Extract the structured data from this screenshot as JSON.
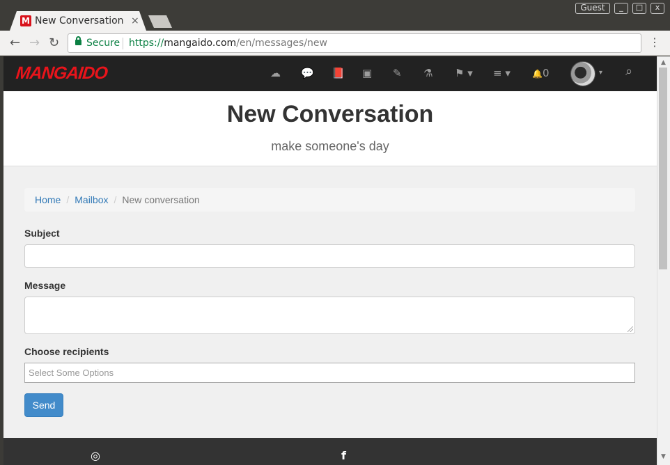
{
  "browser": {
    "tab_title": "New Conversation",
    "tab_close": "×",
    "favicon_letter": "M",
    "profile_label": "Guest",
    "window_controls": {
      "minimize": "_",
      "maximize": "□",
      "close": "x"
    },
    "nav": {
      "back": "←",
      "forward": "→",
      "reload": "↻"
    },
    "secure_label": "Secure",
    "url": {
      "scheme": "https://",
      "host": "mangaido.com",
      "path": "/en/messages/new"
    },
    "menu": "⋮"
  },
  "navbar": {
    "brand": "MANGAIDO",
    "icons": [
      {
        "name": "upload-icon",
        "glyph": "☁"
      },
      {
        "name": "comments-icon",
        "glyph": "💬"
      },
      {
        "name": "book-icon",
        "glyph": "📕"
      },
      {
        "name": "image-icon",
        "glyph": "▣"
      },
      {
        "name": "edit-icon",
        "glyph": "✎"
      },
      {
        "name": "mortar-icon",
        "glyph": "⚗"
      },
      {
        "name": "flag-icon",
        "glyph": "⚑ ▾"
      },
      {
        "name": "list-icon",
        "glyph": "≡ ▾"
      }
    ],
    "notifications": {
      "glyph": "🔔",
      "count": "0"
    },
    "avatar_caret": "▾",
    "search_glyph": "⌕"
  },
  "header": {
    "title": "New Conversation",
    "subtitle": "make someone's day"
  },
  "breadcrumb": {
    "items": [
      "Home",
      "Mailbox"
    ],
    "separator": "/",
    "active": "New conversation"
  },
  "form": {
    "subject_label": "Subject",
    "subject_value": "",
    "message_label": "Message",
    "message_value": "",
    "recipients_label": "Choose recipients",
    "recipients_placeholder": "Select Some Options",
    "send_label": "Send"
  },
  "footer": {
    "icons": [
      {
        "name": "instagram-icon",
        "glyph": "◎"
      },
      {
        "name": "facebook-icon",
        "glyph": "f"
      }
    ]
  },
  "colors": {
    "brand_red": "#e8141b",
    "navbar_bg": "#222222",
    "link_blue": "#337ab7",
    "button_blue": "#428bca",
    "secure_green": "#0b8043"
  }
}
